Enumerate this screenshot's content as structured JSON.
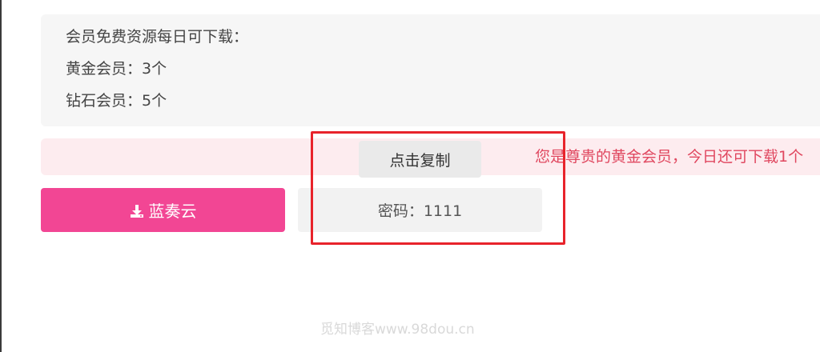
{
  "info": {
    "heading": "会员免费资源每日可下载：",
    "gold": "黄金会员：3个",
    "diamond": "钻石会员：5个"
  },
  "notice": {
    "text": "您是尊贵的黄金会员，今日还可下载1个"
  },
  "download_button": {
    "icon": "download-icon",
    "label": "蓝奏云"
  },
  "password": {
    "label": "密码：1111"
  },
  "tooltip": {
    "label": "点击复制"
  },
  "watermark": {
    "text": "觅知博客www.98dou.cn"
  },
  "colors": {
    "button_pink": "#f24694",
    "notice_text": "#e0475f",
    "notice_bg": "#fdecef",
    "highlight_red": "#e8232b"
  }
}
